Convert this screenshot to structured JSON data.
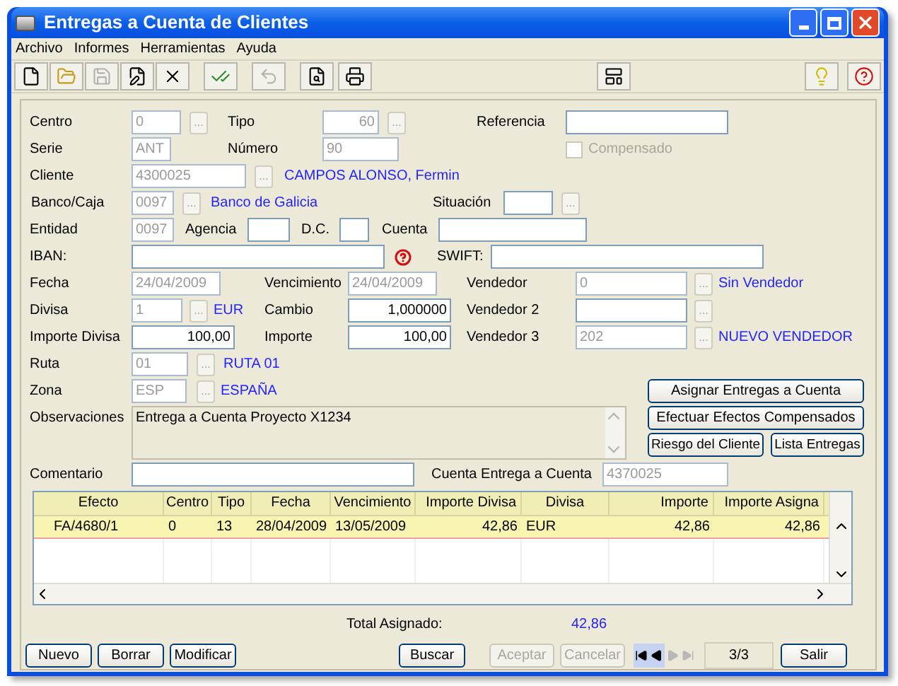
{
  "window": {
    "title": "Entregas a Cuenta de Clientes"
  },
  "menu": [
    "Archivo",
    "Informes",
    "Herramientas",
    "Ayuda"
  ],
  "toolbar": [
    {
      "kind": "new",
      "disabled": false
    },
    {
      "kind": "open",
      "disabled": false
    },
    {
      "kind": "save",
      "disabled": true
    },
    {
      "kind": "edit",
      "disabled": false
    },
    {
      "kind": "delete",
      "disabled": false
    },
    {
      "kind": "check",
      "disabled": false
    },
    {
      "kind": "undo",
      "disabled": true
    },
    {
      "kind": "preview",
      "disabled": false
    },
    {
      "kind": "print",
      "disabled": false
    },
    {
      "kind": "layout",
      "disabled": false
    },
    {
      "kind": "tip",
      "disabled": false
    },
    {
      "kind": "help",
      "disabled": false
    }
  ],
  "form": {
    "centro": {
      "label": "Centro",
      "value": "0",
      "disabled": true,
      "lookup": "..."
    },
    "tipo": {
      "label": "Tipo",
      "value": "60",
      "disabled": true,
      "lookup": "..."
    },
    "referencia": {
      "label": "Referencia",
      "disabled": false
    },
    "serie": {
      "label": "Serie",
      "value": "ANT",
      "disabled": true
    },
    "numero": {
      "label": "Número",
      "value": "90",
      "disabled": true
    },
    "compensado": {
      "label": "Compensado",
      "checked": false,
      "disabled": true
    },
    "cliente": {
      "label": "Cliente",
      "value": "4300025",
      "disabled": true,
      "lookup": "...",
      "description": "CAMPOS ALONSO, Fermin"
    },
    "banco": {
      "label": "Banco/Caja",
      "value": "0097",
      "disabled": true,
      "lookup": "...",
      "description": "Banco de Galicia"
    },
    "situacion": {
      "label": "Situación",
      "disabled": false,
      "lookup": "..."
    },
    "entidad": {
      "label": "Entidad",
      "value": "0097",
      "disabled": true
    },
    "agencia": {
      "label": "Agencia",
      "disabled": false
    },
    "dc": {
      "label": "D.C.",
      "disabled": false
    },
    "cuenta": {
      "label": "Cuenta",
      "disabled": false
    },
    "iban": {
      "label": "IBAN:",
      "disabled": false
    },
    "swift": {
      "label": "SWIFT:",
      "disabled": false
    },
    "fecha": {
      "label": "Fecha",
      "value": "24/04/2009",
      "disabled": true
    },
    "vencimiento": {
      "label": "Vencimiento",
      "value": "24/04/2009",
      "disabled": true
    },
    "vendedor": {
      "label": "Vendedor",
      "value": "0",
      "disabled": true,
      "lookup": "...",
      "description": "Sin Vendedor"
    },
    "divisa": {
      "label": "Divisa",
      "value": "1",
      "disabled": true,
      "lookup": "...",
      "description": "EUR"
    },
    "cambio": {
      "label": "Cambio",
      "value": "1,000000",
      "disabled": false
    },
    "vendedor2": {
      "label": "Vendedor 2",
      "disabled": false,
      "lookup": "..."
    },
    "importe_divisa": {
      "label": "Importe Divisa",
      "value": "100,00",
      "disabled": false
    },
    "importe": {
      "label": "Importe",
      "value": "100,00",
      "disabled": false
    },
    "vendedor3": {
      "label": "Vendedor 3",
      "value": "202",
      "disabled": true,
      "lookup": "...",
      "description": "NUEVO VENDEDOR"
    },
    "ruta": {
      "label": "Ruta",
      "value": "01",
      "disabled": true,
      "lookup": "...",
      "description": "RUTA 01"
    },
    "zona": {
      "label": "Zona",
      "value": "ESP",
      "disabled": true,
      "lookup": "...",
      "description": "ESPAÑA"
    },
    "observaciones": {
      "label": "Observaciones",
      "value": "Entrega a Cuenta Proyecto X1234",
      "disabled": false
    },
    "comentario": {
      "label": "Comentario",
      "disabled": false
    },
    "cuenta_entrega": {
      "label": "Cuenta Entrega a Cuenta",
      "value": "4370025",
      "disabled": true
    }
  },
  "side_buttons": [
    "Asignar Entregas a Cuenta",
    "Efectuar Efectos Compensados",
    "Riesgo del Cliente",
    "Lista Entregas"
  ],
  "table": {
    "columns": [
      "Efecto",
      "Centro",
      "Tipo",
      "Fecha",
      "Vencimiento",
      "Importe Divisa",
      "Divisa",
      "Importe",
      "Importe Asigna"
    ],
    "rows": [
      {
        "selected": true,
        "cells": [
          "FA/4680/1",
          "0",
          "13",
          "28/04/2009",
          "13/05/2009",
          "42,86",
          "EUR",
          "42,86",
          "42,86"
        ]
      }
    ]
  },
  "total": {
    "label": "Total Asignado:",
    "value": "42,86"
  },
  "actions": [
    {
      "label": "Nuevo",
      "disabled": false
    },
    {
      "label": "Borrar",
      "disabled": false
    },
    {
      "label": "Modificar",
      "disabled": false
    },
    {
      "label": "Buscar",
      "disabled": false
    },
    {
      "label": "Aceptar",
      "disabled": true
    },
    {
      "label": "Cancelar",
      "disabled": true
    },
    {
      "label": "Salir",
      "disabled": false
    }
  ],
  "navigator": [
    {
      "kind": "first",
      "disabled": false
    },
    {
      "kind": "prev",
      "disabled": false
    },
    {
      "kind": "next",
      "disabled": true
    },
    {
      "kind": "last",
      "disabled": true
    }
  ],
  "record": "3/3"
}
